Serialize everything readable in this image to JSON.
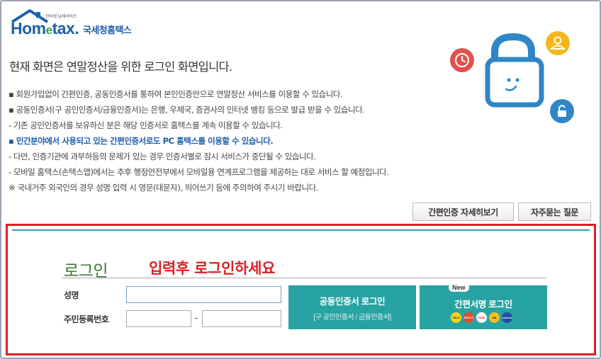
{
  "logo": {
    "small_text": "인터넷 납세서비스",
    "word_main": "Hom",
    "word_e": "e",
    "word_tail": "tax.",
    "korean": "국세청홈택스"
  },
  "heading": "현재 화면은 연말정산을 위한 로그인 화면입니다.",
  "notes": [
    {
      "style": "normal",
      "text": "▪ 회원가입없이 간편인증, 공동인증서를 통하여 본인인증만으로 연말정산 서비스를 이용할 수 있습니다."
    },
    {
      "style": "normal",
      "text": "▪ 공동인증서(구 공인인증서/금융인증서)는 은행, 우체국, 증권사의 인터넷 뱅킹 등으로 발급 받을 수 있습니다."
    },
    {
      "style": "normal",
      "text": "- 기존 공인인증서를 보유하신 분은 해당 인증서로 홈택스를 계속 이용할 수 있습니다."
    },
    {
      "style": "blue",
      "text": "▪ 민간분야에서 사용되고 있는 간편인증서로도 PC 홈택스를 이용할 수 있습니다."
    },
    {
      "style": "normal",
      "text": "- 다만, 인증기관에 과부하등의 문제가 있는 경우 인증서별로 잠시 서비스가 중단될 수 있습니다."
    },
    {
      "style": "normal",
      "text": "- 모바일 홈택스(손택스앱)에서는 추후 행정안전부에서 모바일용 연계프로그램을 제공하는 대로 서비스 할 예정입니다."
    },
    {
      "style": "normal",
      "text": "※ 국내거주 외국인의 경우 성명 입력 시 영문(대문자), 띄어쓰기 등에 주의하여 주시기 바랍니다."
    }
  ],
  "buttons": {
    "easy_auth_detail": "간편인증 자세히보기",
    "faq": "자주묻는 질문"
  },
  "login": {
    "title": "로그인",
    "hint": "입력후 로그인하세요",
    "name_label": "성명",
    "rrn_label": "주민등록번호",
    "rrn_separator": "-",
    "name_value": "",
    "rrn_front_value": "",
    "rrn_back_value": "",
    "cert_button_label": "공동인증서 로그인",
    "cert_button_sub": "[구 공인인증서 / 금융인증서]",
    "easy_button_badge": "New",
    "easy_button_label": "간편서명 로그인",
    "easy_provider_icons": [
      {
        "label": "TALK",
        "color": "#f7d417"
      },
      {
        "label": "PAYCO",
        "color": "#e74a31"
      },
      {
        "label": "PASS",
        "color": "#ffffff"
      },
      {
        "label": "KB",
        "color": "#f2c21b"
      },
      {
        "label": "SAMSUNG",
        "color": "#1d4fa3"
      }
    ]
  },
  "colors": {
    "accent_red": "#e01d24",
    "teal_button": "#27a3a3",
    "brand_blue": "#1f5fa8",
    "login_green": "#3d7a2e"
  }
}
